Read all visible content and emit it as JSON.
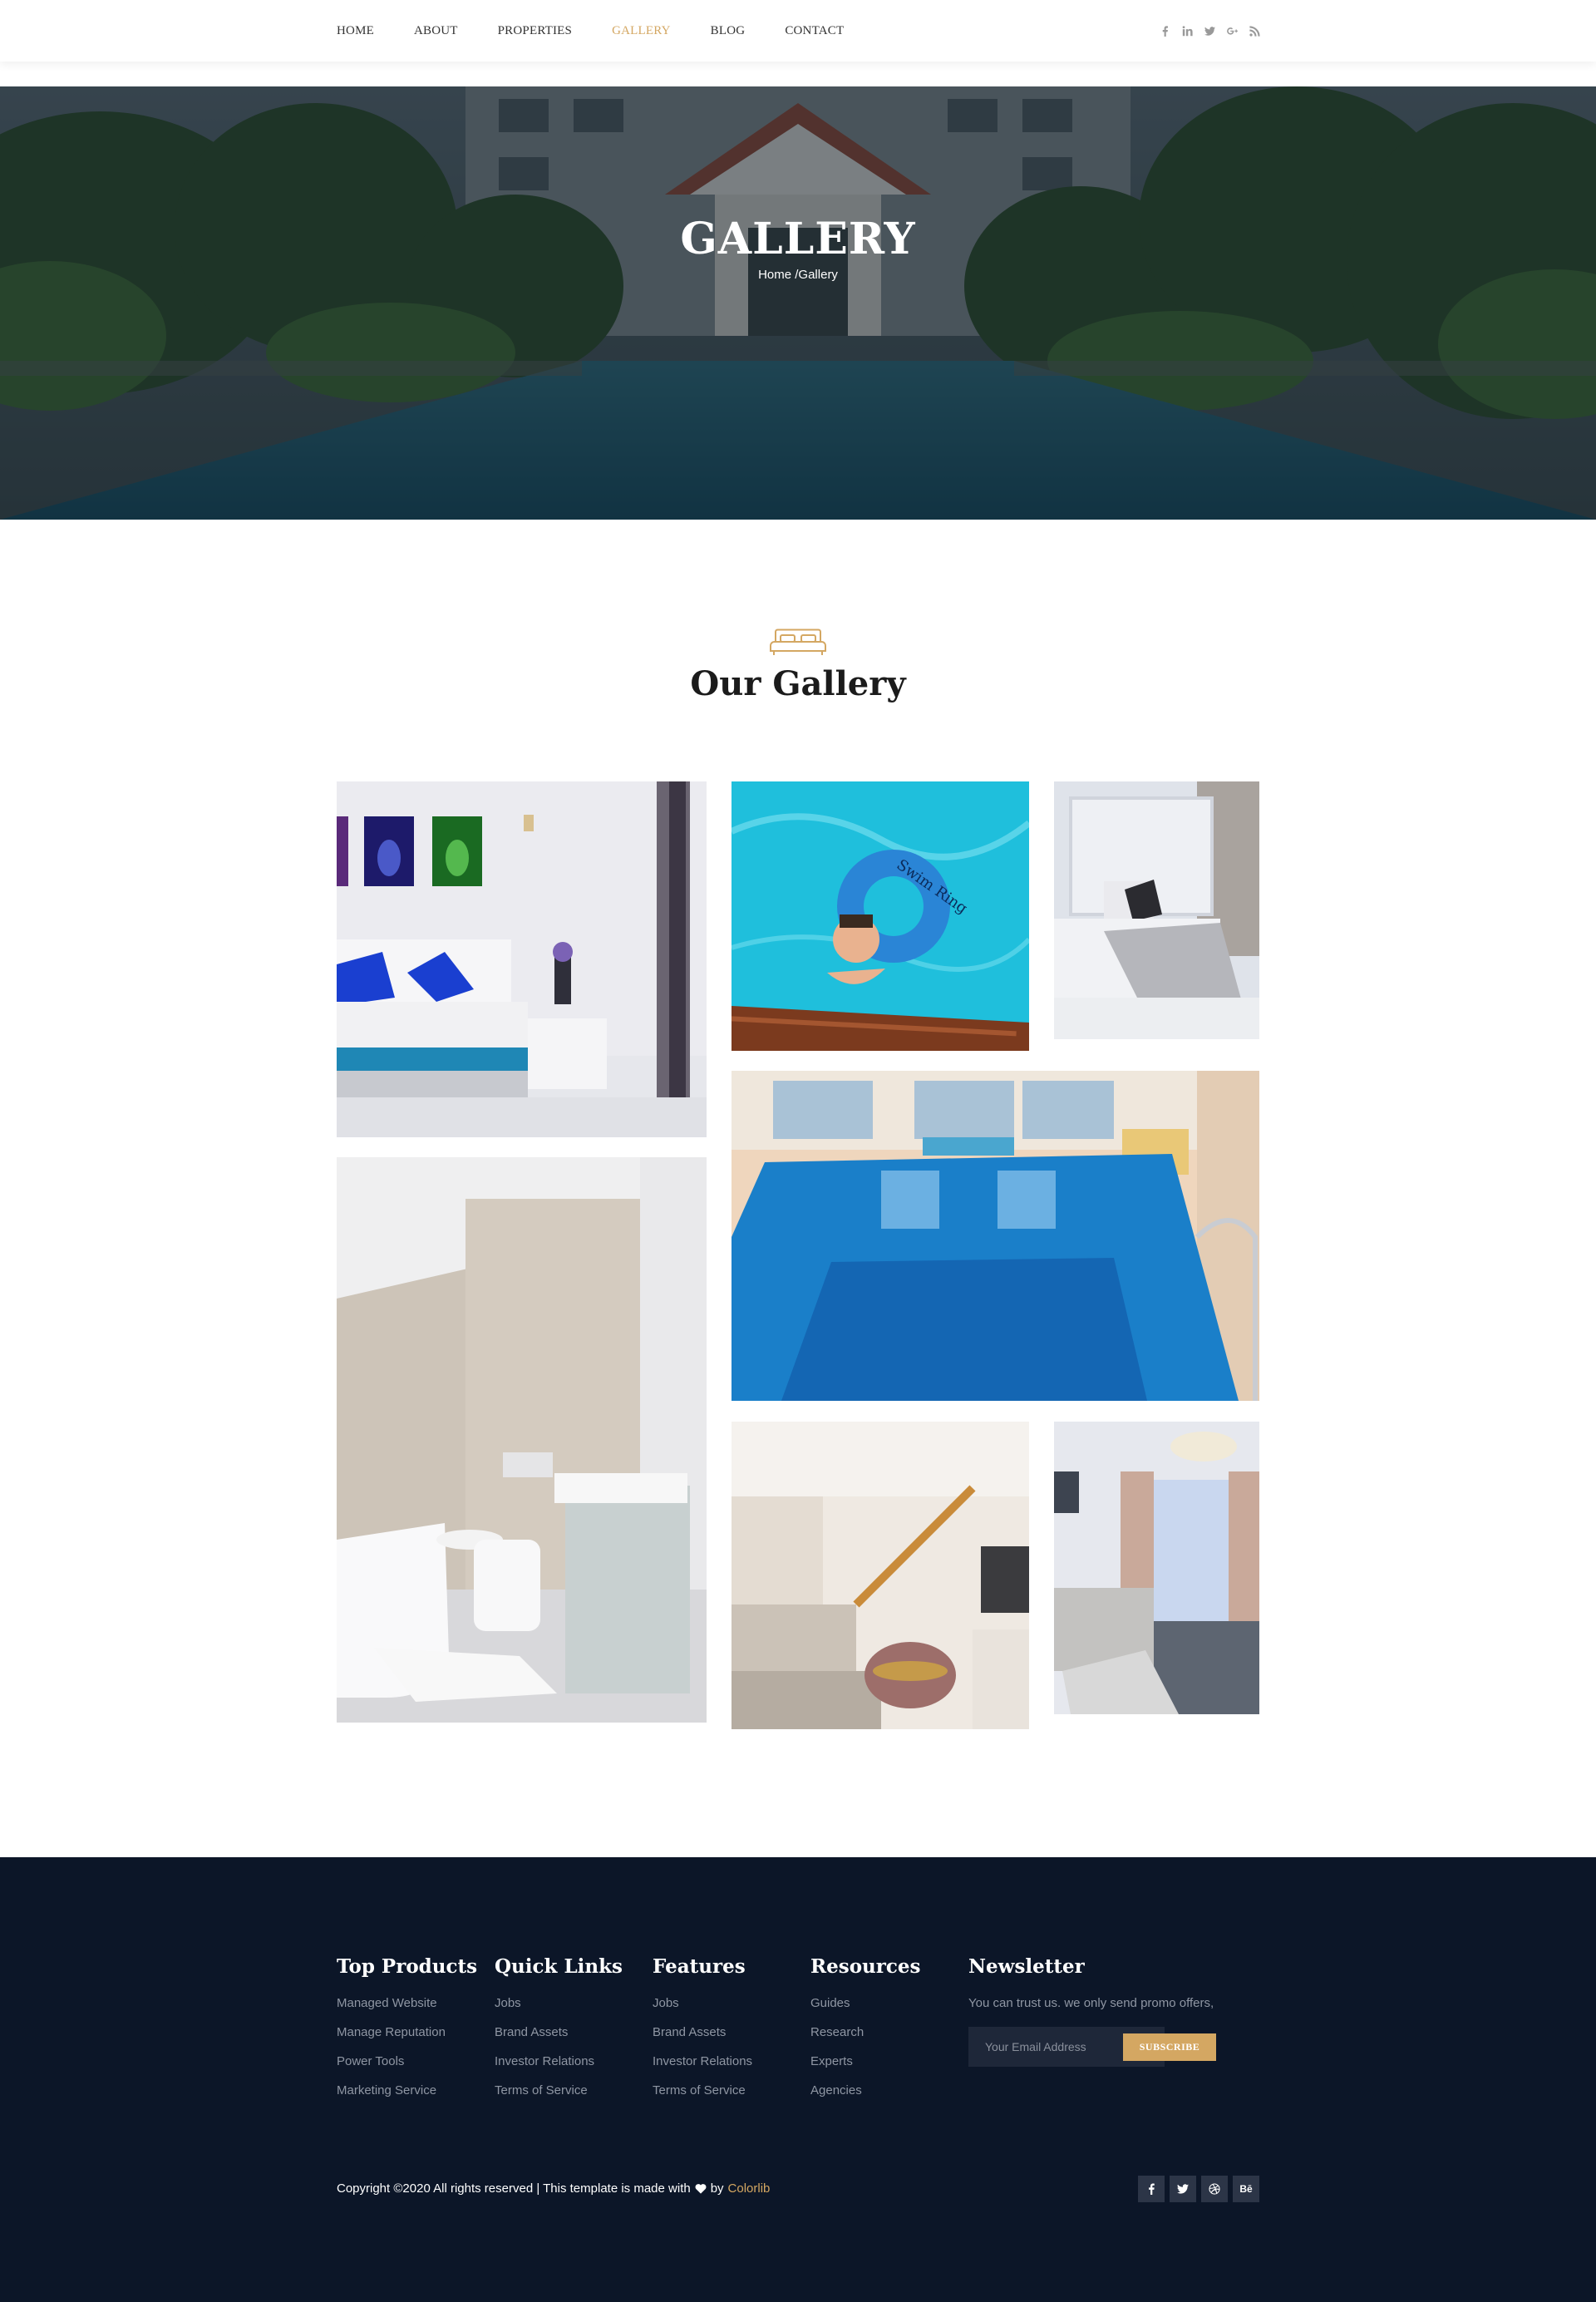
{
  "nav": {
    "items": [
      {
        "label": "HOME",
        "active": false
      },
      {
        "label": "ABOUT",
        "active": false
      },
      {
        "label": "PROPERTIES",
        "active": false
      },
      {
        "label": "GALLERY",
        "active": true
      },
      {
        "label": "BLOG",
        "active": false
      },
      {
        "label": "CONTACT",
        "active": false
      }
    ],
    "social_icons": [
      "facebook-icon",
      "linkedin-icon",
      "twitter-icon",
      "google-plus-icon",
      "rss-icon"
    ]
  },
  "hero": {
    "title": "GALLERY",
    "breadcrumb": {
      "home": "Home",
      "separator": "/",
      "current": "Gallery"
    }
  },
  "gallery": {
    "icon": "bed-icon",
    "title": "Our Gallery",
    "images": [
      "bedroom-blue-pillows",
      "boy-swim-ring",
      "bedroom-white",
      "indoor-pool",
      "bathroom",
      "living-room-stairs",
      "living-room-chandelier"
    ]
  },
  "footer": {
    "columns": [
      {
        "title": "Top Products",
        "links": [
          "Managed Website",
          "Manage Reputation",
          "Power Tools",
          "Marketing Service"
        ]
      },
      {
        "title": "Quick Links",
        "links": [
          "Jobs",
          "Brand Assets",
          "Investor Relations",
          "Terms of Service"
        ]
      },
      {
        "title": "Features",
        "links": [
          "Jobs",
          "Brand Assets",
          "Investor Relations",
          "Terms of Service"
        ]
      },
      {
        "title": "Resources",
        "links": [
          "Guides",
          "Research",
          "Experts",
          "Agencies"
        ]
      }
    ],
    "newsletter": {
      "title": "Newsletter",
      "text": "You can trust us. we only send promo offers,",
      "placeholder": "Your Email Address",
      "button": "SUBSCRIBE"
    },
    "copyright": {
      "text": "Copyright ©2020 All rights reserved | This template is made with",
      "by": "by",
      "link": "Colorlib"
    },
    "social_icons": [
      "facebook-icon",
      "twitter-icon",
      "dribbble-icon",
      "behance-icon"
    ],
    "behance_label": "Bē"
  },
  "colors": {
    "accent": "#d4a762",
    "footer_bg": "#0c1628",
    "text_dark": "#1b1b1b",
    "muted": "#8f96a3"
  }
}
